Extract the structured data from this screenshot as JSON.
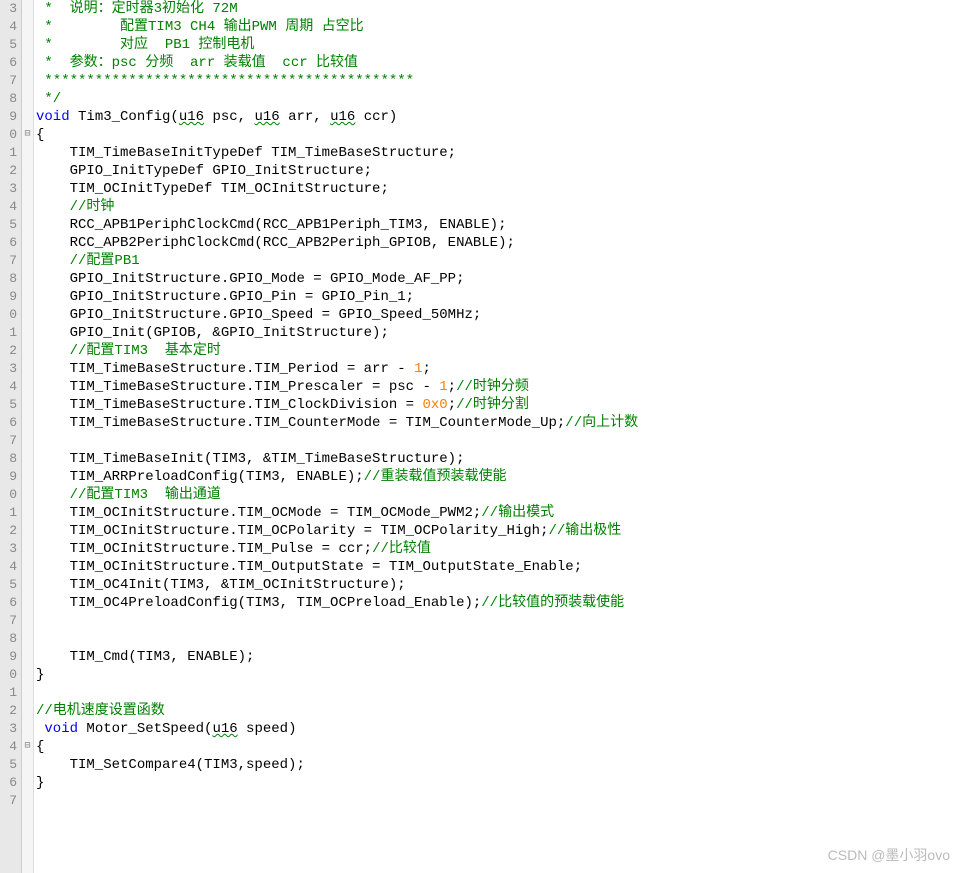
{
  "gutter": [
    "3",
    "4",
    "5",
    "6",
    "7",
    "8",
    "9",
    "0",
    "1",
    "2",
    "3",
    "4",
    "5",
    "6",
    "7",
    "8",
    "9",
    "0",
    "1",
    "2",
    "3",
    "4",
    "5",
    "6",
    "7",
    "8",
    "9",
    "0",
    "1",
    "2",
    "3",
    "4",
    "5",
    "6",
    "7",
    "8",
    "9",
    "0",
    "1",
    "2",
    "3",
    "4",
    "5",
    "6",
    "7"
  ],
  "fold": [
    "",
    "",
    "",
    "",
    "",
    "",
    "",
    "⊟",
    "",
    "",
    "",
    "",
    "",
    "",
    "",
    "",
    "",
    "",
    "",
    "",
    "",
    "",
    "",
    "",
    "",
    "",
    "",
    "",
    "",
    "",
    "",
    "",
    "",
    "",
    "",
    "",
    "",
    "",
    "",
    "",
    "",
    "⊟",
    "",
    "",
    ""
  ],
  "lines": [
    {
      "t": "comment",
      "text": " *  说明：定时器3初始化 72M"
    },
    {
      "t": "comment",
      "text": " *        配置TIM3 CH4 输出PWM 周期 占空比"
    },
    {
      "t": "comment",
      "text": " *        对应  PB1 控制电机"
    },
    {
      "t": "comment",
      "text": " *  参数：psc 分频  arr 装载值  ccr 比较值"
    },
    {
      "t": "comment",
      "text": " ********************************************"
    },
    {
      "t": "comment",
      "text": " */"
    },
    {
      "t": "sig",
      "kw": "void",
      "name": " Tim3_Config(",
      "p1": "u16",
      "a1": " psc, ",
      "p2": "u16",
      "a2": " arr, ",
      "p3": "u16",
      "a3": " ccr)"
    },
    {
      "t": "plain",
      "text": "{"
    },
    {
      "t": "plain",
      "text": "    TIM_TimeBaseInitTypeDef TIM_TimeBaseStructure;"
    },
    {
      "t": "plain",
      "text": "    GPIO_InitTypeDef GPIO_InitStructure;"
    },
    {
      "t": "plain",
      "text": "    TIM_OCInitTypeDef TIM_OCInitStructure;"
    },
    {
      "t": "lc",
      "text": "    ",
      "c": "//时钟"
    },
    {
      "t": "plain",
      "text": "    RCC_APB1PeriphClockCmd(RCC_APB1Periph_TIM3, ENABLE);"
    },
    {
      "t": "plain",
      "text": "    RCC_APB2PeriphClockCmd(RCC_APB2Periph_GPIOB, ENABLE);"
    },
    {
      "t": "lc",
      "text": "    ",
      "c": "//配置PB1"
    },
    {
      "t": "plain",
      "text": "    GPIO_InitStructure.GPIO_Mode = GPIO_Mode_AF_PP;"
    },
    {
      "t": "plain",
      "text": "    GPIO_InitStructure.GPIO_Pin = GPIO_Pin_1;"
    },
    {
      "t": "plain",
      "text": "    GPIO_InitStructure.GPIO_Speed = GPIO_Speed_50MHz;"
    },
    {
      "t": "plain",
      "text": "    GPIO_Init(GPIOB, &GPIO_InitStructure);"
    },
    {
      "t": "lc",
      "text": "    ",
      "c": "//配置TIM3  基本定时"
    },
    {
      "t": "mix",
      "pre": "    TIM_TimeBaseStructure.TIM_Period = arr - ",
      "num": "1",
      "post": ";"
    },
    {
      "t": "mix2",
      "pre": "    TIM_TimeBaseStructure.TIM_Prescaler = psc - ",
      "num": "1",
      "post": ";",
      "c": "//时钟分频"
    },
    {
      "t": "mix2",
      "pre": "    TIM_TimeBaseStructure.TIM_ClockDivision = ",
      "num": "0x0",
      "post": ";",
      "c": "//时钟分割"
    },
    {
      "t": "tc",
      "text": "    TIM_TimeBaseStructure.TIM_CounterMode = TIM_CounterMode_Up;",
      "c": "//向上计数"
    },
    {
      "t": "plain",
      "text": ""
    },
    {
      "t": "plain",
      "text": "    TIM_TimeBaseInit(TIM3, &TIM_TimeBaseStructure);"
    },
    {
      "t": "tc",
      "text": "    TIM_ARRPreloadConfig(TIM3, ENABLE);",
      "c": "//重装载值预装载使能"
    },
    {
      "t": "lc",
      "text": "    ",
      "c": "//配置TIM3  输出通道"
    },
    {
      "t": "tc",
      "text": "    TIM_OCInitStructure.TIM_OCMode = TIM_OCMode_PWM2;",
      "c": "//输出模式"
    },
    {
      "t": "tc",
      "text": "    TIM_OCInitStructure.TIM_OCPolarity = TIM_OCPolarity_High;",
      "c": "//输出极性"
    },
    {
      "t": "tc",
      "text": "    TIM_OCInitStructure.TIM_Pulse = ccr;",
      "c": "//比较值"
    },
    {
      "t": "plain",
      "text": "    TIM_OCInitStructure.TIM_OutputState = TIM_OutputState_Enable;"
    },
    {
      "t": "plain",
      "text": "    TIM_OC4Init(TIM3, &TIM_OCInitStructure);"
    },
    {
      "t": "tc",
      "text": "    TIM_OC4PreloadConfig(TIM3, TIM_OCPreload_Enable);",
      "c": "//比较值的预装载使能"
    },
    {
      "t": "plain",
      "text": ""
    },
    {
      "t": "plain",
      "text": ""
    },
    {
      "t": "plain",
      "text": "    TIM_Cmd(TIM3, ENABLE);"
    },
    {
      "t": "plain",
      "text": "}"
    },
    {
      "t": "plain",
      "text": ""
    },
    {
      "t": "comment",
      "text": "//电机速度设置函数"
    },
    {
      "t": "sig2",
      "kw": "void",
      "name": " Motor_SetSpeed(",
      "p1": "u16",
      "a1": " speed)"
    },
    {
      "t": "plain",
      "text": "{"
    },
    {
      "t": "plain",
      "text": "    TIM_SetCompare4(TIM3,speed);"
    },
    {
      "t": "plain",
      "text": "}"
    },
    {
      "t": "plain",
      "text": ""
    }
  ],
  "watermark": "CSDN @墨小羽ovo"
}
